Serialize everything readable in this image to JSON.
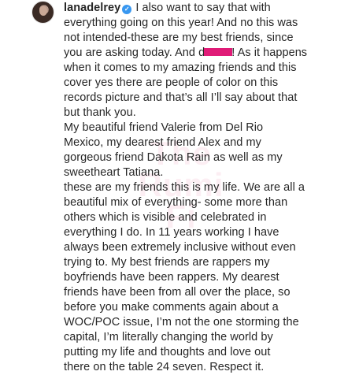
{
  "profile": {
    "username": "lanadelrey",
    "verified_icon": "verified-badge-icon"
  },
  "comment": {
    "lines_p1": [
      "I also want to say that with",
      "everything going on this year! And no this was",
      "not intended-these are my best friends, since",
      "you are asking today. And d",
      "! As it happens",
      "when it comes to my amazing friends and this",
      "cover yes there are people of color on this",
      "records picture and that’s all I’ll say about that",
      "but thank you."
    ],
    "lines_p2": [
      "My beautiful friend Valerie from Del Rio",
      "Mexico, my dearest friend Alex and my",
      "gorgeous friend Dakota Rain as well as my",
      "sweetheart Tatiana."
    ],
    "lines_p3": [
      "these are my friends this is my life. We are all a",
      "beautiful mix of everything- some more than",
      "others which is visible and celebrated in",
      "everything I do. In 11 years working I have",
      "always been extremely inclusive without even",
      "trying to. My best friends are rappers my",
      "boyfriends have been rappers. My dearest",
      "friends have been from all over the place, so",
      "before you make comments again  about a",
      "WOC/POC issue, I’m not the one storming the",
      "capital, I’m literally changing the world by",
      "putting my life and thoughts and love  out",
      "there on the table 24 seven. Respect it."
    ],
    "censor_color": "#e01b77"
  },
  "watermark": {
    "lines": [
      "The",
      "Rumi",
      "Fi"
    ]
  }
}
